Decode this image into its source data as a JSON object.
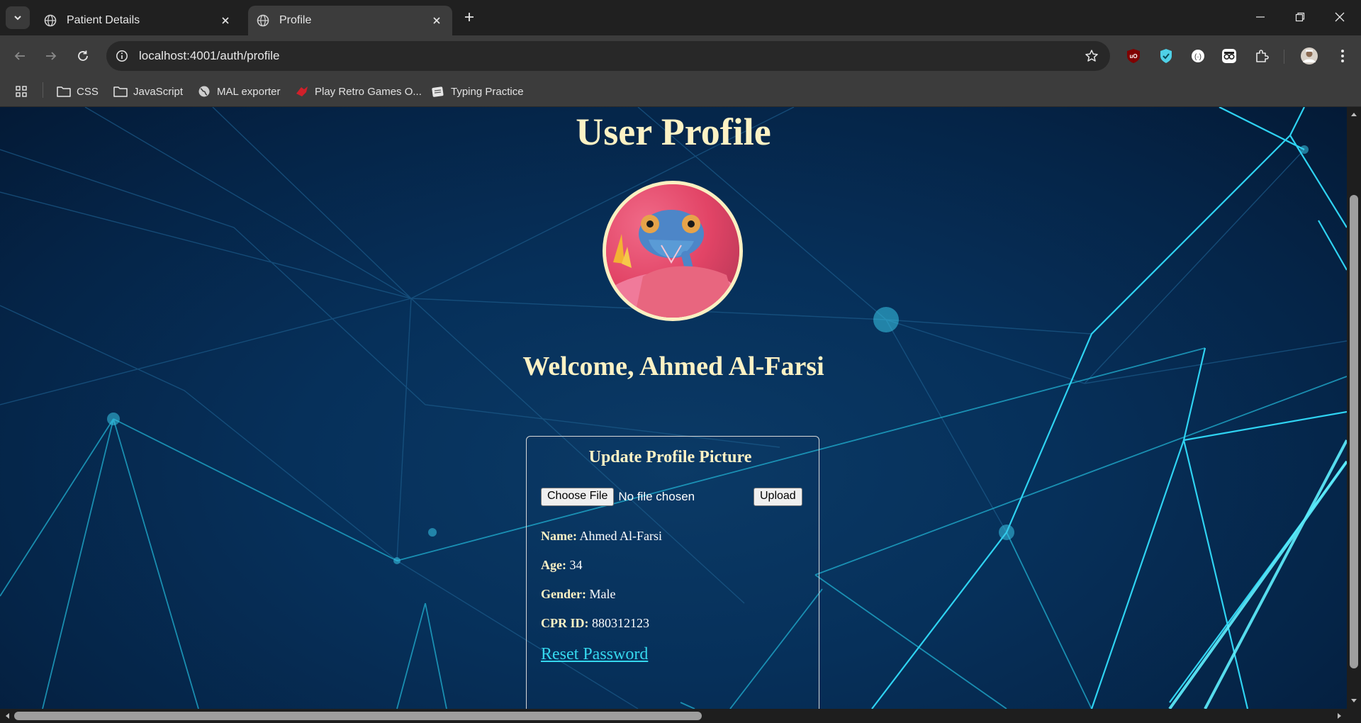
{
  "browser": {
    "tabs": [
      {
        "title": "Patient Details",
        "icon": "globe-icon",
        "active": false
      },
      {
        "title": "Profile",
        "icon": "globe-icon",
        "active": true
      }
    ],
    "url": "localhost:4001/auth/profile",
    "bookmarks": [
      {
        "label": "CSS",
        "icon": "folder-icon"
      },
      {
        "label": "JavaScript",
        "icon": "folder-icon"
      },
      {
        "label": "MAL exporter",
        "icon": "globe-icon"
      },
      {
        "label": "Play Retro Games O...",
        "icon": "game-controller-icon"
      },
      {
        "label": "Typing Practice",
        "icon": "typing-icon"
      }
    ],
    "extensions": [
      "ublock-icon",
      "shield-extension-icon",
      "circle-extension-icon",
      "glasses-extension-icon",
      "puzzle-icon",
      "profile-avatar"
    ]
  },
  "page": {
    "title": "User Profile",
    "welcome": "Welcome, Ahmed Al-Farsi",
    "update_card": {
      "title": "Update Profile Picture",
      "choose_file_label": "Choose File",
      "file_status": "No file chosen",
      "upload_label": "Upload"
    },
    "details": [
      {
        "label": "Name:",
        "value": "Ahmed Al-Farsi"
      },
      {
        "label": "Age:",
        "value": "34"
      },
      {
        "label": "Gender:",
        "value": "Male"
      },
      {
        "label": "CPR ID:",
        "value": "880312123"
      }
    ],
    "reset_password": "Reset Password"
  },
  "colors": {
    "heading": "#fdf2c4",
    "link": "#35d7ee",
    "page_background": "#06305a"
  }
}
